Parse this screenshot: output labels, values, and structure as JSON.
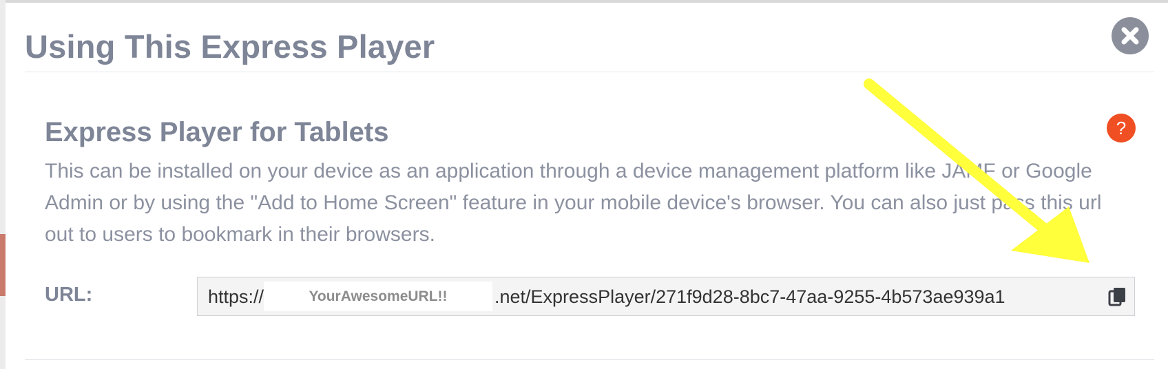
{
  "modal": {
    "title": "Using This Express Player",
    "close_icon": "close-circle-icon"
  },
  "section": {
    "title": "Express Player for Tablets",
    "help_label": "?",
    "help_color": "#f04f23",
    "description": "This can be installed on your device as an application through a device management platform like JAMF or Google Admin or by using the \"Add to Home Screen\" feature in your mobile device's browser. You can also just pass this url out to users to bookmark in their browsers."
  },
  "url_field": {
    "label": "URL:",
    "prefix": "https://",
    "redaction_text": "YourAwesomeURL!!",
    "rest": ".net/ExpressPlayer/271f9d28-8bc7-47aa-9255-4b573ae939a1",
    "copy_icon": "copy-icon"
  },
  "annotation": {
    "icon": "yellow-arrow-annotation",
    "color": "#ffff3b"
  }
}
